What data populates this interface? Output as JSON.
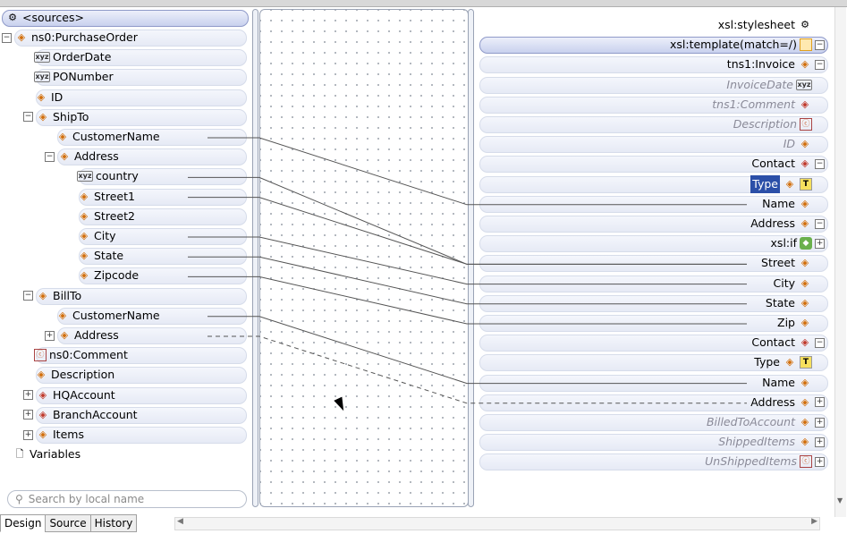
{
  "sources": {
    "header": "<sources>",
    "rows": [
      {
        "label": "ns0:PurchaseOrder",
        "icon": "element",
        "indent": 1,
        "expander": "minus"
      },
      {
        "label": "OrderDate",
        "icon": "attribute",
        "indent": 2
      },
      {
        "label": "PONumber",
        "icon": "attribute",
        "indent": 2
      },
      {
        "label": "ID",
        "icon": "element",
        "indent": 2
      },
      {
        "label": "ShipTo",
        "icon": "element",
        "indent": 2,
        "expander": "minus"
      },
      {
        "label": "CustomerName",
        "icon": "element",
        "indent": 3
      },
      {
        "label": "Address",
        "icon": "element",
        "indent": 3,
        "expander": "minus"
      },
      {
        "label": "country",
        "icon": "attribute",
        "indent": 4
      },
      {
        "label": "Street1",
        "icon": "element",
        "indent": 4
      },
      {
        "label": "Street2",
        "icon": "element",
        "indent": 4
      },
      {
        "label": "City",
        "icon": "element",
        "indent": 4
      },
      {
        "label": "State",
        "icon": "element",
        "indent": 4
      },
      {
        "label": "Zipcode",
        "icon": "element",
        "indent": 4
      },
      {
        "label": "BillTo",
        "icon": "element",
        "indent": 2,
        "expander": "minus"
      },
      {
        "label": "CustomerName",
        "icon": "element",
        "indent": 3
      },
      {
        "label": "Address",
        "icon": "element",
        "indent": 3,
        "expander": "plus"
      },
      {
        "label": "ns0:Comment",
        "icon": "comment",
        "indent": 2
      },
      {
        "label": "Description",
        "icon": "element",
        "indent": 2
      },
      {
        "label": "HQAccount",
        "icon": "choice",
        "indent": 2,
        "expander": "plus"
      },
      {
        "label": "BranchAccount",
        "icon": "choice",
        "indent": 2,
        "expander": "plus"
      },
      {
        "label": "Items",
        "icon": "element",
        "indent": 2,
        "expander": "plus"
      },
      {
        "label": "Variables",
        "icon": "file",
        "indent": 1
      }
    ],
    "search_placeholder": "Search by local name"
  },
  "target": {
    "rows": [
      {
        "label": "xsl:stylesheet",
        "icon": "stylesheet",
        "style": "plain"
      },
      {
        "label": "xsl:template(match=/)",
        "icon": "template",
        "style": "selected",
        "expander": "minus"
      },
      {
        "label": "tns1:Invoice",
        "icon": "element",
        "style": "plain",
        "expander": "minus"
      },
      {
        "label": "InvoiceDate",
        "icon": "attribute",
        "style": "dim"
      },
      {
        "label": "tns1:Comment",
        "icon": "choice",
        "style": "dim"
      },
      {
        "label": "Description",
        "icon": "comment",
        "style": "dim"
      },
      {
        "label": "ID",
        "icon": "element",
        "style": "dim"
      },
      {
        "label": "Contact",
        "icon": "choice",
        "style": "plain",
        "expander": "minus"
      },
      {
        "label": "Type",
        "icon": "element",
        "style": "highlight",
        "extra": "T"
      },
      {
        "label": "Name",
        "icon": "element",
        "style": "plain"
      },
      {
        "label": "Address",
        "icon": "element",
        "style": "plain",
        "expander": "minus"
      },
      {
        "label": "xsl:if",
        "icon": "if",
        "style": "plain",
        "expander": "plus"
      },
      {
        "label": "Street",
        "icon": "element",
        "style": "plain"
      },
      {
        "label": "City",
        "icon": "element",
        "style": "plain"
      },
      {
        "label": "State",
        "icon": "element",
        "style": "plain"
      },
      {
        "label": "Zip",
        "icon": "element",
        "style": "plain"
      },
      {
        "label": "Contact",
        "icon": "choice",
        "style": "plain",
        "expander": "minus"
      },
      {
        "label": "Type",
        "icon": "element",
        "style": "plain",
        "extra": "T"
      },
      {
        "label": "Name",
        "icon": "element",
        "style": "plain"
      },
      {
        "label": "Address",
        "icon": "element",
        "style": "plain",
        "expander": "plus"
      },
      {
        "label": "BilledToAccount",
        "icon": "element",
        "style": "dim",
        "expander": "plus"
      },
      {
        "label": "ShippedItems",
        "icon": "element",
        "style": "dim",
        "expander": "plus"
      },
      {
        "label": "UnShippedItems",
        "icon": "comment",
        "style": "dim",
        "expander": "plus"
      }
    ]
  },
  "links": [
    {
      "from": 5,
      "to": 9,
      "style": "solid"
    },
    {
      "from": 7,
      "to": 12,
      "style": "solid"
    },
    {
      "from": 8,
      "to": 12,
      "style": "solid"
    },
    {
      "from": 10,
      "to": 13,
      "style": "solid"
    },
    {
      "from": 11,
      "to": 14,
      "style": "solid"
    },
    {
      "from": 12,
      "to": 15,
      "style": "solid"
    },
    {
      "from": 14,
      "to": 18,
      "style": "solid"
    },
    {
      "from": 15,
      "to": 19,
      "style": "dashed"
    }
  ],
  "tabs": [
    "Design",
    "Source",
    "History"
  ],
  "active_tab": "Design",
  "colors": {
    "element": "#d26e0a",
    "highlight": "#2b4fa8",
    "link": "#555555"
  }
}
